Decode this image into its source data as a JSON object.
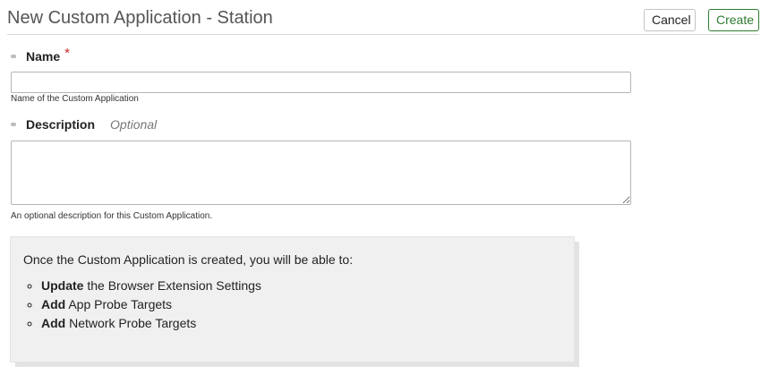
{
  "header": {
    "title": "New Custom Application - Station",
    "cancel_label": "Cancel",
    "create_label": "Create"
  },
  "form": {
    "name": {
      "label": "Name",
      "required_marker": "*",
      "value": "",
      "placeholder": "",
      "help": "Name of the Custom Application"
    },
    "description": {
      "label": "Description",
      "optional_tag": "Optional",
      "value": "",
      "placeholder": "",
      "help": "An optional description for this Custom Application."
    }
  },
  "info": {
    "intro": "Once the Custom Application is created, you will be able to:",
    "items": [
      {
        "action": "Update",
        "text": " the Browser Extension Settings"
      },
      {
        "action": "Add",
        "text": " App Probe Targets"
      },
      {
        "action": "Add",
        "text": " Network Probe Targets"
      }
    ]
  },
  "colors": {
    "create_accent": "#2e7d32",
    "required_marker": "#c62828",
    "info_background": "#f0f0f0"
  }
}
